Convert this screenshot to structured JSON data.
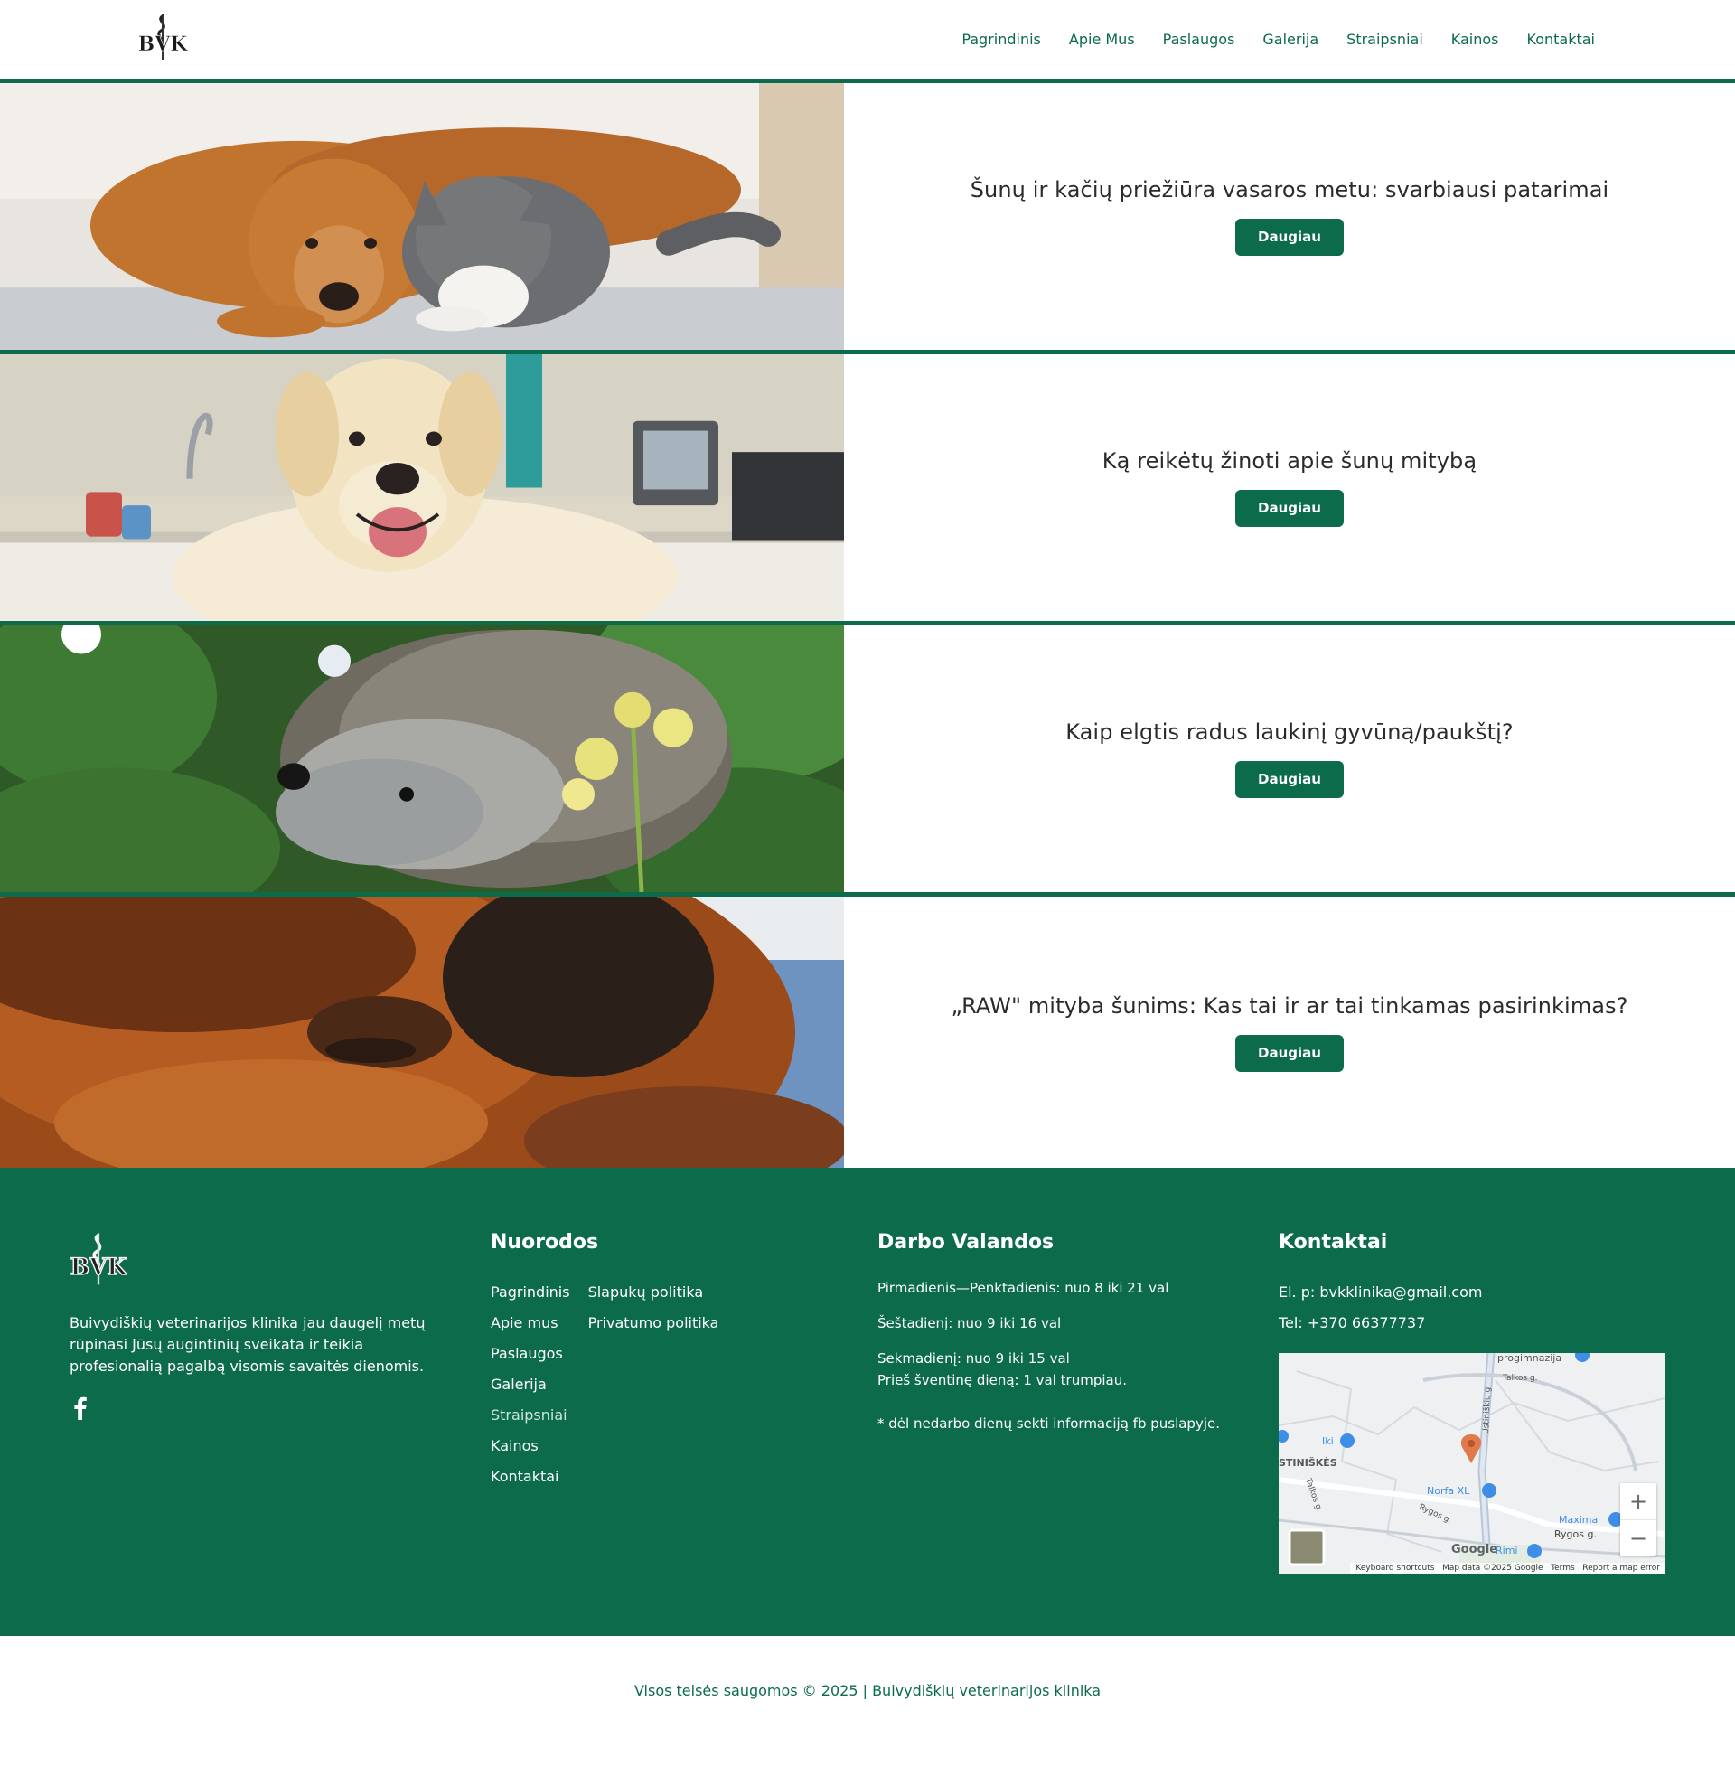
{
  "header": {
    "logo_text": "BVK",
    "nav": [
      "Pagrindinis",
      "Apie Mus",
      "Paslaugos",
      "Galerija",
      "Straipsniai",
      "Kainos",
      "Kontaktai"
    ]
  },
  "articles": [
    {
      "title": "Šunų ir kačių priežiūra vasaros metu: svarbiausi patarimai",
      "button": "Daugiau",
      "image": "dog-and-cat"
    },
    {
      "title": "Ką reikėtų žinoti apie šunų mitybą",
      "button": "Daugiau",
      "image": "golden-retriever"
    },
    {
      "title": "Kaip elgtis radus laukinį gyvūną/paukštį?",
      "button": "Daugiau",
      "image": "hedgehog"
    },
    {
      "title": "„RAW\" mityba šunims: Kas tai ir ar tai tinkamas pasirinkimas?",
      "button": "Daugiau",
      "image": "dog-closeup"
    }
  ],
  "footer": {
    "about": {
      "logo_text": "BVK",
      "text": "Buivydiškių veterinarijos klinika jau daugelį metų rūpinasi Jūsų augintinių sveikata ir teikia profesionalią pagalbą visomis savaitės dienomis.",
      "social_icon": "facebook-icon"
    },
    "links": {
      "title": "Nuorodos",
      "col1": [
        "Pagrindinis",
        "Apie mus",
        "Paslaugos",
        "Galerija",
        "Straipsniai",
        "Kainos",
        "Kontaktai"
      ],
      "col2": [
        "Slapukų politika",
        "Privatumo politika"
      ]
    },
    "hours": {
      "title": "Darbo Valandos",
      "weekdays": "Pirmadienis—Penktadienis: nuo 8 iki 21 val",
      "saturday": "Šeštadienį: nuo 9 iki 16 val",
      "sunday": "Sekmadienį: nuo 9 iki 15 val",
      "holiday": "Prieš šventinę dieną: 1 val trumpiau.",
      "note": "* dėl nedarbo dienų sekti informaciją fb puslapyje."
    },
    "contact": {
      "title": "Kontaktai",
      "email": "El. p: bvkklinika@gmail.com",
      "phone": "Tel: +370 66377737",
      "map": {
        "labels": [
          "progimnazija",
          "Talkos g.",
          "Iki",
          "STINIŠKĖS",
          "Norfa XL",
          "Rygos g.",
          "Maxima",
          "Rygos g.",
          "Rimi",
          "Talkos g.",
          "Ustiniškių g."
        ],
        "logo": "Google",
        "attribution": [
          "Keyboard shortcuts",
          "Map data ©2025 Google",
          "Terms",
          "Report a map error"
        ],
        "zoom_in": "+",
        "zoom_out": "−"
      }
    }
  },
  "copyright": "Visos teisės saugomos © 2025 | Buivydiškių veterinarijos klinika"
}
